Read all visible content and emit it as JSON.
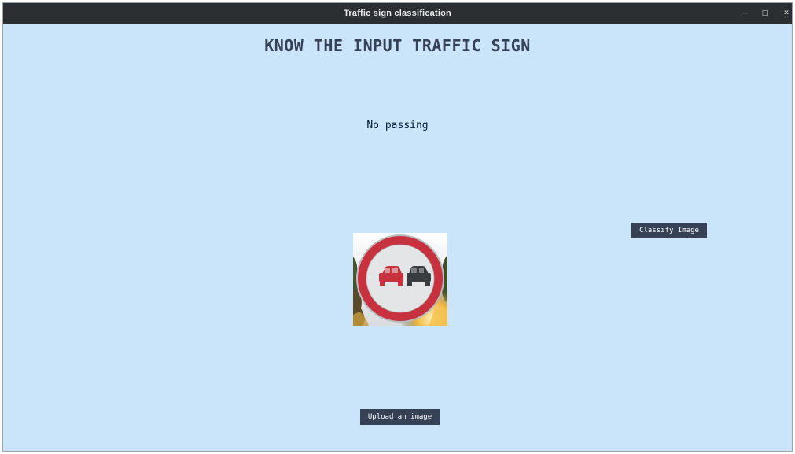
{
  "window": {
    "title": "Traffic sign classification",
    "controls": {
      "minimize_icon": "minimize-icon",
      "maximize_icon": "maximize-icon",
      "close_icon": "close-icon"
    }
  },
  "main": {
    "heading": "KNOW THE INPUT TRAFFIC SIGN",
    "prediction_label": "No passing",
    "classify_button_label": "Classify Image",
    "upload_button_label": "Upload an image"
  },
  "image": {
    "icon": "no-passing-sign"
  },
  "colors": {
    "background": "#cae5f9",
    "titlebar": "#2c2f31",
    "heading_text": "#364156",
    "button_bg": "#364156",
    "button_text": "#ffffff",
    "label_text": "#011638",
    "sign_ring": "#c8323e"
  }
}
